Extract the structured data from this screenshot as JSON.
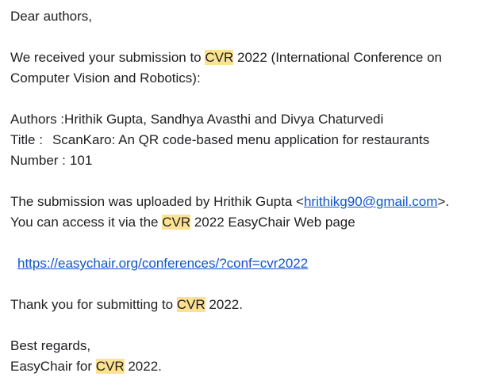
{
  "email": {
    "greeting": "Dear authors,",
    "received_prefix": "We received your submission to ",
    "conf_acronym": "CVR",
    "received_suffix": " 2022 (International Conference on",
    "received_line2": "Computer Vision and Robotics):",
    "authors_label": "Authors : ",
    "authors_value": "Hrithik Gupta, Sandhya Avasthi and Divya Chaturvedi",
    "title_label": "Title :",
    "title_value": "ScanKaro: An QR code-based menu application for restaurants",
    "number_label": "Number :",
    "number_value": "101",
    "uploaded_prefix": "The submission was uploaded by Hrithik Gupta <",
    "uploader_email": "hrithikg90@gmail.com",
    "uploaded_suffix": ">.",
    "access_prefix": "You can access it via the ",
    "access_suffix": " 2022 EasyChair Web page",
    "url": "https://easychair.org/conferences/?conf=cvr2022",
    "thanks_prefix": "Thank you for submitting to ",
    "thanks_suffix": " 2022.",
    "regards": "Best regards,",
    "signoff_prefix": "EasyChair for ",
    "signoff_suffix": " 2022."
  },
  "colors": {
    "highlight": "#fde293",
    "link": "#1155cc",
    "text": "#202124"
  }
}
